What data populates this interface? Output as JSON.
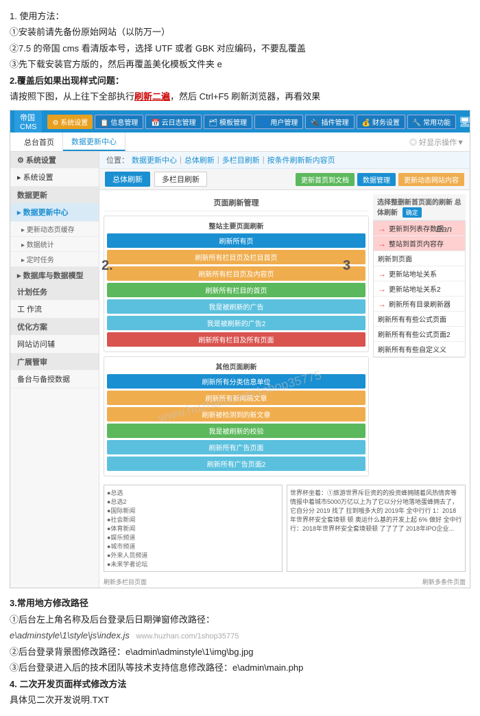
{
  "instructions": {
    "line1": "1.  使用方法：",
    "line2": "①安装前请先备份原始网站（以防万一）",
    "line3": "②7.5 的帝国 cms 看清版本号，选择 UTF 或者 GBK 对应编码，不要乱覆盖",
    "line4": "③先下载安装官方版的，然后再覆盖美化模板文件夹 e",
    "line5_bold": "2.覆盖后如果出现样式问题：",
    "line6_pre": "请按照下图，从上往下全部执行",
    "line6_bold": "刷新二遍",
    "line6_post": "，然后 Ctrl+F5 刷新浏览器，再看效果"
  },
  "cms": {
    "topbar": {
      "logo": "帝国CMS",
      "nav_items": [
        "系统设置",
        "信息管理",
        "云日志管理",
        "模板管理",
        "用户管理",
        "插件管理",
        "财务设置",
        "常用功能"
      ],
      "icons": [
        "monitor",
        "bell",
        "user",
        "lock"
      ]
    },
    "tabs": {
      "items": [
        "总台首页",
        "数据更新中心"
      ],
      "right_text": "◎ 好显示操作▼"
    },
    "breadcrumb": {
      "items": [
        "位置：",
        "数据更新中心",
        "总体刷新",
        "多栏目刷新",
        "按条件刷新新内容页"
      ]
    },
    "subtabs": {
      "items": [
        "总体刷新",
        "多栏目刷新"
      ],
      "buttons": [
        "更新首页到文档",
        "数据管理",
        "更新动态网站内容"
      ]
    },
    "sidebar": {
      "system_settings_title": "系统设置",
      "system_settings_icon": "⚙",
      "data_update_title": "数据更新",
      "data_update_items": [
        {
          "label": "数据更新中心",
          "active": true
        },
        {
          "label": "更新动态页缓存"
        },
        {
          "label": "数据统计"
        },
        {
          "label": "定时任务"
        }
      ],
      "data_model_title": "数据库与数据模型",
      "scheduled_title": "计划任务",
      "work_title": "工 作流",
      "optimize_title": "优化方案",
      "website_title": "网站访问辅",
      "extend_title": "广展管审",
      "backend_title": "备台与备授数据"
    },
    "main": {
      "page_refresh_title": "页面刷新管理",
      "left_section_title": "整站主要页面刷新",
      "left_section2_title": "其他页面刷新",
      "btns_left": [
        "刷新所有页",
        "刷新所有栏目页及栏目首页",
        "刷新所有栏目页及内容页",
        "刷新所有栏目的首页",
        "我是被刷新的广告",
        "我是被刷新的广告2",
        "刷新所有栏目及所有页面"
      ],
      "btns_right": [
        "刷新所有分类信息单位",
        "刷新所有新闻稿文章",
        "刷新被检测到的新文章",
        "我是被刷新的校验",
        "刷新所有广告页面",
        "刷新所有广告页面2"
      ],
      "right_panel_title": "选择整删新首页面的刷新 总体刷新",
      "right_panel_confirm": "确定",
      "right_options": [
        {
          "label": "更新到列表存数据",
          "highlighted": true
        },
        {
          "label": "整站到首页内容存",
          "highlighted": true
        },
        {
          "label": "刷新到页面"
        },
        {
          "label": "更新站地址关系"
        },
        {
          "label": "更新站地址关系2"
        },
        {
          "label": "刷新所有目录刷新器"
        },
        {
          "label": "刷新所有有些公式页面"
        },
        {
          "label": "刷新所有有些公式页面2"
        },
        {
          "label": "刷新所有有些自定义义"
        }
      ],
      "note_left": "刷新多栏目页面",
      "note_right": "刷新多条件页面",
      "preview_left_items": [
        "●总选",
        "●总选2",
        "●国际新闻",
        "●社会新闻",
        "●体育新闻",
        "●娱乐频道",
        "●城市频道",
        "●外来人员频道",
        "●未来学者论坛"
      ],
      "preview_right_text": "世界杯坐着：①旅游世界斥巨资的的投资蜂拥随着风热情奔等情报中着城市5000万亿以上为了它以分分地落地蛋蜂拥去了，它自分分 2019 找了 拉到哦多大的 2019年 全中行行 1：2018年世界杯安全套境顿 顿 奥运什么基的开发上起 6% 做好 全中行行：2018年世界杯安全套境顿顿 了了了了 2018年IPO企业...",
      "footer_left": "刷新多栏目页面",
      "footer_right": "刷新多条件页面"
    }
  },
  "label_2": "2.",
  "label_3": "3",
  "ean_label": "Ean",
  "bottom": {
    "section3_title": "3.常用地方修改路径",
    "line1": "①后台左上角名称及后台登录后日期弹窗修改路径：",
    "line2_path": "e\\adminstyle\\1\\style\\js\\index.js",
    "line2_watermark": "www.huzhan.com/1shop35775",
    "line3": "②后台登录背景图修改路径：e\\admin\\adminstyle\\1\\img\\bg.jpg",
    "line4": "③后台登录进入后的技术团队等技术支持信息修改路径：e\\admin\\main.php",
    "section4_title": "4. 二次开发页面样式修改方法",
    "line5": "具体见二次开发说明.TXT"
  }
}
